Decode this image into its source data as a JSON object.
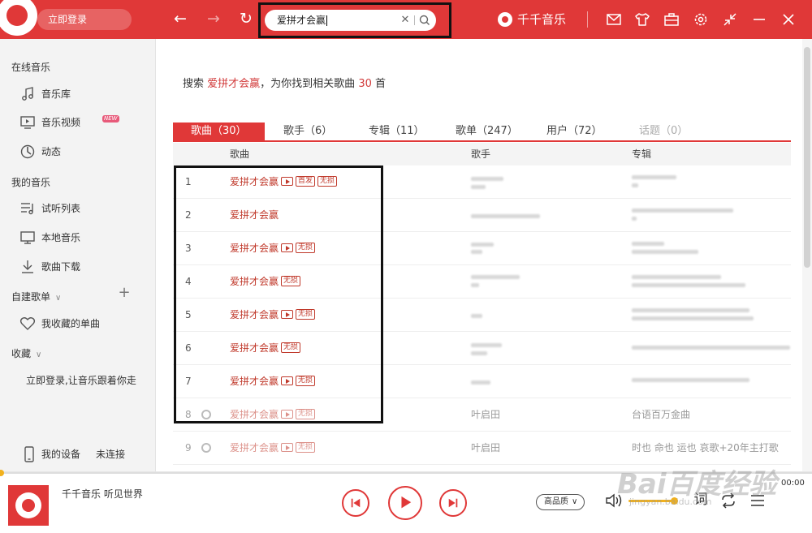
{
  "topbar": {
    "login_label": "立即登录",
    "search": {
      "query": "爱拼才会赢"
    },
    "brand": "千千音乐"
  },
  "sidebar": {
    "sections": {
      "online": "在线音乐",
      "mine": "我的音乐",
      "custom": "自建歌单",
      "favorites": "收藏"
    },
    "items": [
      {
        "label": "音乐库",
        "icon": "music-note-icon"
      },
      {
        "label": "音乐视频",
        "icon": "video-icon",
        "badge": "NEW"
      },
      {
        "label": "动态",
        "icon": "activity-icon"
      },
      {
        "label": "试听列表",
        "icon": "playlist-icon"
      },
      {
        "label": "本地音乐",
        "icon": "monitor-icon"
      },
      {
        "label": "歌曲下载",
        "icon": "download-icon"
      },
      {
        "label": "我收藏的单曲",
        "icon": "heart-icon"
      }
    ],
    "login_prompt": "立即登录,让音乐跟着你走",
    "device": {
      "label": "我的设备",
      "status": "未连接"
    }
  },
  "main": {
    "summary": {
      "prefix": "搜索",
      "keyword": "爱拼才会赢",
      "middle": "，为你找到相关歌曲",
      "count": "30",
      "suffix": "首"
    },
    "tabs": [
      {
        "label": "歌曲（30）"
      },
      {
        "label": "歌手（6）"
      },
      {
        "label": "专辑（11）"
      },
      {
        "label": "歌单（247）"
      },
      {
        "label": "用户（72）"
      },
      {
        "label": "话题（0）"
      }
    ],
    "columns": [
      "歌曲",
      "歌手",
      "专辑"
    ],
    "rows": [
      {
        "num": "1",
        "title": "爱拼才会赢",
        "tags": [
          "首发",
          "无损"
        ]
      },
      {
        "num": "2",
        "title": "爱拼才会赢",
        "tags": []
      },
      {
        "num": "3",
        "title": "爱拼才会赢",
        "tags": [
          "无损"
        ]
      },
      {
        "num": "4",
        "title": "爱拼才会赢",
        "tags": [
          "无损"
        ]
      },
      {
        "num": "5",
        "title": "爱拼才会赢",
        "tags": [
          "无损"
        ]
      },
      {
        "num": "6",
        "title": "爱拼才会赢",
        "tags": [
          "无损"
        ]
      },
      {
        "num": "7",
        "title": "爱拼才会赢",
        "tags": [
          "无损"
        ]
      },
      {
        "num": "8",
        "title": "爱拼才会赢",
        "tags": [
          "无损"
        ],
        "singer": "叶启田",
        "album": "台语百万金曲"
      },
      {
        "num": "9",
        "title": "爱拼才会赢",
        "tags": [
          "无损"
        ],
        "singer": "叶启田",
        "album": "时也 命也 运也 哀歌+20年主打歌"
      }
    ]
  },
  "player": {
    "now_playing": "千千音乐 听见世界",
    "time": "00:00",
    "quality": "高品质",
    "lyric_label": "词",
    "watermark": "Bai百度经验",
    "watermark_sub": "jingyan.baidu.com"
  },
  "colors": {
    "accent": "#e03838",
    "song_title": "#c0392b",
    "volume": "#f2b11d"
  }
}
